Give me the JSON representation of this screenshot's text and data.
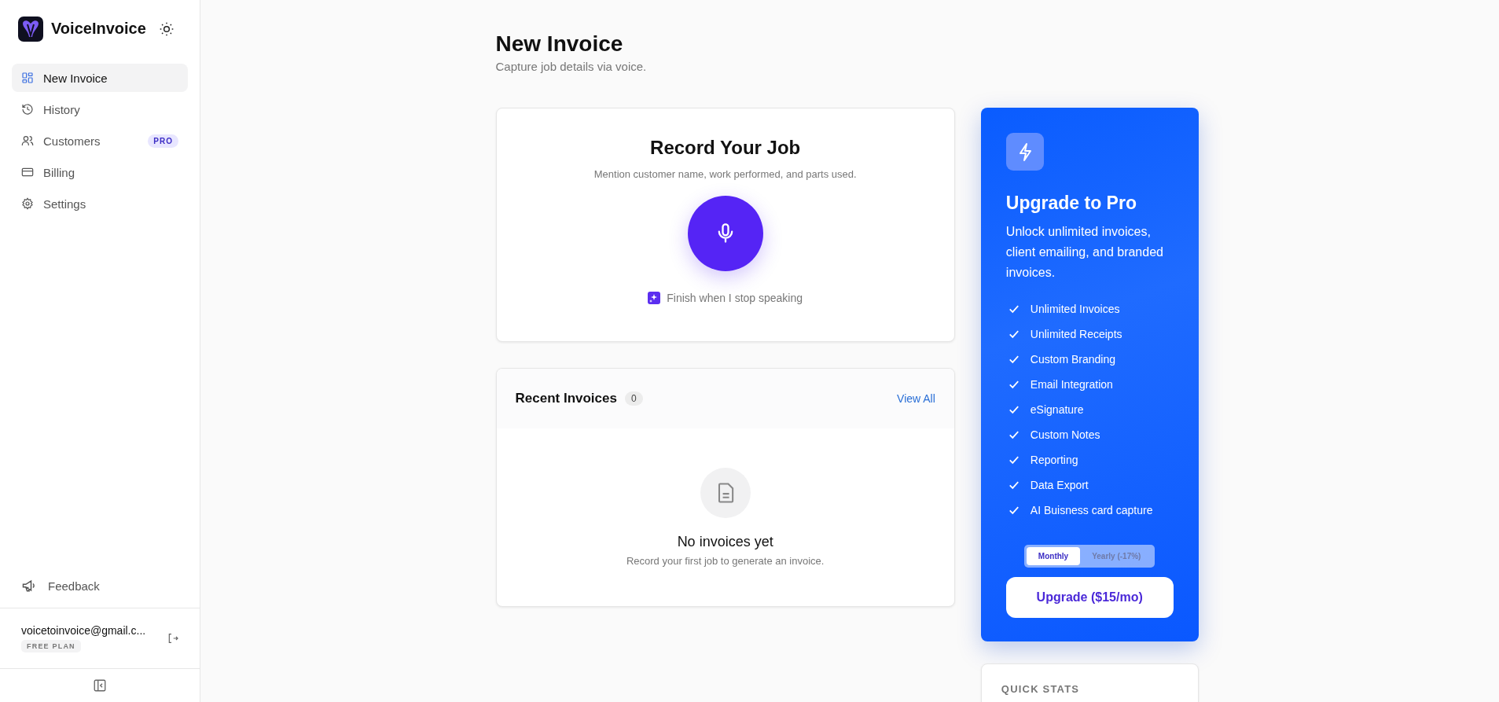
{
  "sidebar": {
    "brand": "VoiceInvoice",
    "items": [
      {
        "label": "New Invoice",
        "kind": "grid",
        "selected": true
      },
      {
        "label": "History",
        "kind": "history",
        "selected": false
      },
      {
        "label": "Customers",
        "kind": "users",
        "selected": false,
        "badge": "PRO"
      },
      {
        "label": "Billing",
        "kind": "card",
        "selected": false
      },
      {
        "label": "Settings",
        "kind": "gear",
        "selected": false
      }
    ],
    "feedback": "Feedback",
    "account": {
      "email": "voicetoinvoice@gmail.c...",
      "plan": "FREE PLAN"
    }
  },
  "page": {
    "title": "New Invoice",
    "subtitle": "Capture job details via voice."
  },
  "record": {
    "title": "Record Your Job",
    "hint": "Mention customer name, work performed, and parts used.",
    "auto_finish": {
      "label": "Finish when I stop speaking",
      "checked": true
    }
  },
  "recent": {
    "title": "Recent Invoices",
    "count": "0",
    "link": "View All",
    "empty_title": "No invoices yet",
    "empty_text": "Record your first job to generate an invoice."
  },
  "upgrade": {
    "title": "Upgrade to Pro",
    "text": "Unlock unlimited invoices, client emailing, and branded invoices.",
    "features": [
      "Unlimited Invoices",
      "Unlimited Receipts",
      "Custom Branding",
      "Email Integration",
      "eSignature",
      "Custom Notes",
      "Reporting",
      "Data Export",
      "AI Buisness card capture"
    ],
    "billing": [
      {
        "label": "Monthly",
        "selected": true
      },
      {
        "label": "Yearly (-17%)",
        "selected": false
      }
    ],
    "button": "Upgrade ($15/mo)"
  },
  "quick_stats": {
    "title": "QUICK STATS"
  }
}
